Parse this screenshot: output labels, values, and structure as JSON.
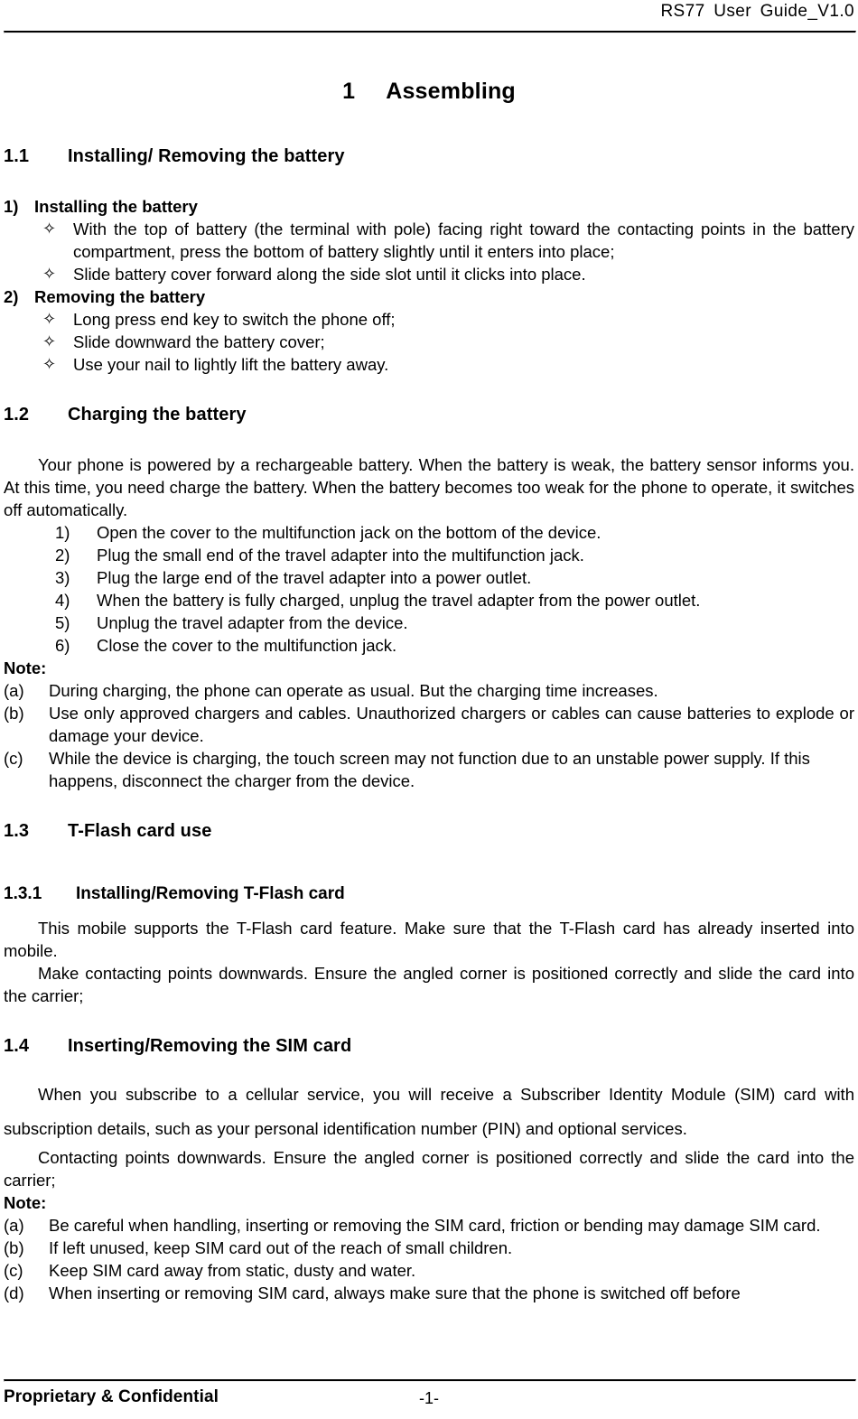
{
  "document": {
    "header_text": "RS77 User Guide_V1.0",
    "chapter": {
      "number": "1",
      "title": "Assembling"
    },
    "footer": {
      "left": "Proprietary & Confidential",
      "page": "-1-"
    }
  },
  "sections": {
    "s1_1": {
      "number": "1.1",
      "title": "Installing/ Removing the battery",
      "sub1": {
        "marker": "1)",
        "title": "Installing the battery",
        "bullets": [
          {
            "glyph": "✧",
            "text": "With the top of battery (the terminal with pole) facing right toward the contacting points in the battery compartment, press the bottom of battery slightly until it enters into place;"
          },
          {
            "glyph": "✧",
            "text": "Slide battery cover forward along the side slot until it clicks into place."
          }
        ]
      },
      "sub2": {
        "marker": "2)",
        "title": "Removing the battery",
        "bullets": [
          {
            "glyph": "✧",
            "text": "Long press end key to switch the phone off;"
          },
          {
            "glyph": "✧",
            "text": "Slide downward the battery cover;"
          },
          {
            "glyph": "✧",
            "text": "Use your nail to lightly lift the battery away."
          }
        ]
      }
    },
    "s1_2": {
      "number": "1.2",
      "title": "Charging the battery",
      "intro": "Your phone is powered by a rechargeable battery. When the battery is weak, the battery sensor informs you. At this time, you need charge the battery. When the battery becomes too weak for the phone to operate, it switches off automatically.",
      "steps": [
        {
          "marker": "1)",
          "text": "Open the cover to the multifunction jack on the bottom of the device."
        },
        {
          "marker": "2)",
          "text": "Plug the small end of the travel adapter into the multifunction jack."
        },
        {
          "marker": "3)",
          "text": "Plug the large end of the travel adapter into a power outlet."
        },
        {
          "marker": "4)",
          "text": "When the battery is fully charged, unplug the travel adapter from the power outlet."
        },
        {
          "marker": "5)",
          "text": "Unplug the travel adapter from the device."
        },
        {
          "marker": "6)",
          "text": "Close the cover to the multifunction jack."
        }
      ],
      "note_label": "Note:",
      "notes": [
        {
          "marker": "(a)",
          "text": "During charging, the phone can operate as usual. But the charging time increases."
        },
        {
          "marker": "(b)",
          "text": "Use only approved chargers and cables. Unauthorized chargers or cables can cause batteries to explode or damage your device."
        },
        {
          "marker": "(c)",
          "text": "While the device is charging, the touch screen may not function due to an unstable power supply. If this happens, disconnect the charger from the device."
        }
      ]
    },
    "s1_3": {
      "number": "1.3",
      "title": "T-Flash card use",
      "sub": {
        "number": "1.3.1",
        "title": "Installing/Removing T-Flash card",
        "para1": "This mobile supports the T-Flash card feature. Make sure that the T-Flash card has already inserted into mobile.",
        "para2": "Make contacting points downwards. Ensure the angled corner is positioned correctly and slide the card into the carrier;"
      }
    },
    "s1_4": {
      "number": "1.4",
      "title": "Inserting/Removing the SIM card",
      "para1": "When you subscribe to a cellular service, you will receive a Subscriber Identity Module (SIM) card with subscription details, such as your personal identification number (PIN) and optional services.",
      "para2": "Contacting points downwards. Ensure the angled corner is positioned correctly and slide the card into the carrier;",
      "note_label": "Note:",
      "notes": [
        {
          "marker": "(a)",
          "text": "Be careful when handling, inserting or removing the SIM card, friction or bending may damage SIM card."
        },
        {
          "marker": "(b)",
          "text": "If left unused, keep SIM card out of the reach of small children."
        },
        {
          "marker": "(c)",
          "text": "Keep SIM card away from static, dusty and water."
        },
        {
          "marker": "(d)",
          "text": "When inserting or removing SIM card, always make sure that the phone is switched off before"
        }
      ]
    }
  }
}
